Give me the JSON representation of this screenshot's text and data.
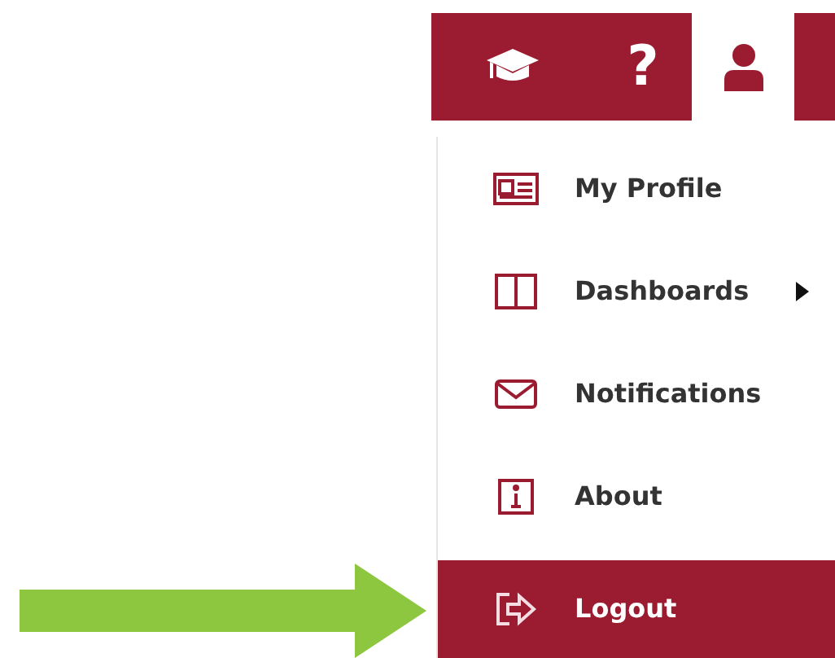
{
  "toolbar": {
    "buttons": [
      {
        "kind": "cap",
        "selected": false
      },
      {
        "kind": "help",
        "glyph": "?",
        "selected": false
      },
      {
        "kind": "user",
        "selected": true
      }
    ]
  },
  "menu": {
    "items": [
      {
        "kind": "profile",
        "label": "My Profile",
        "submenu": false,
        "selected": false
      },
      {
        "kind": "dashboards",
        "label": "Dashboards",
        "submenu": true,
        "selected": false
      },
      {
        "kind": "notifications",
        "label": "Notifications",
        "submenu": false,
        "selected": false
      },
      {
        "kind": "about",
        "label": "About",
        "submenu": false,
        "selected": false
      },
      {
        "kind": "logout",
        "label": "Logout",
        "submenu": false,
        "selected": true
      }
    ]
  }
}
